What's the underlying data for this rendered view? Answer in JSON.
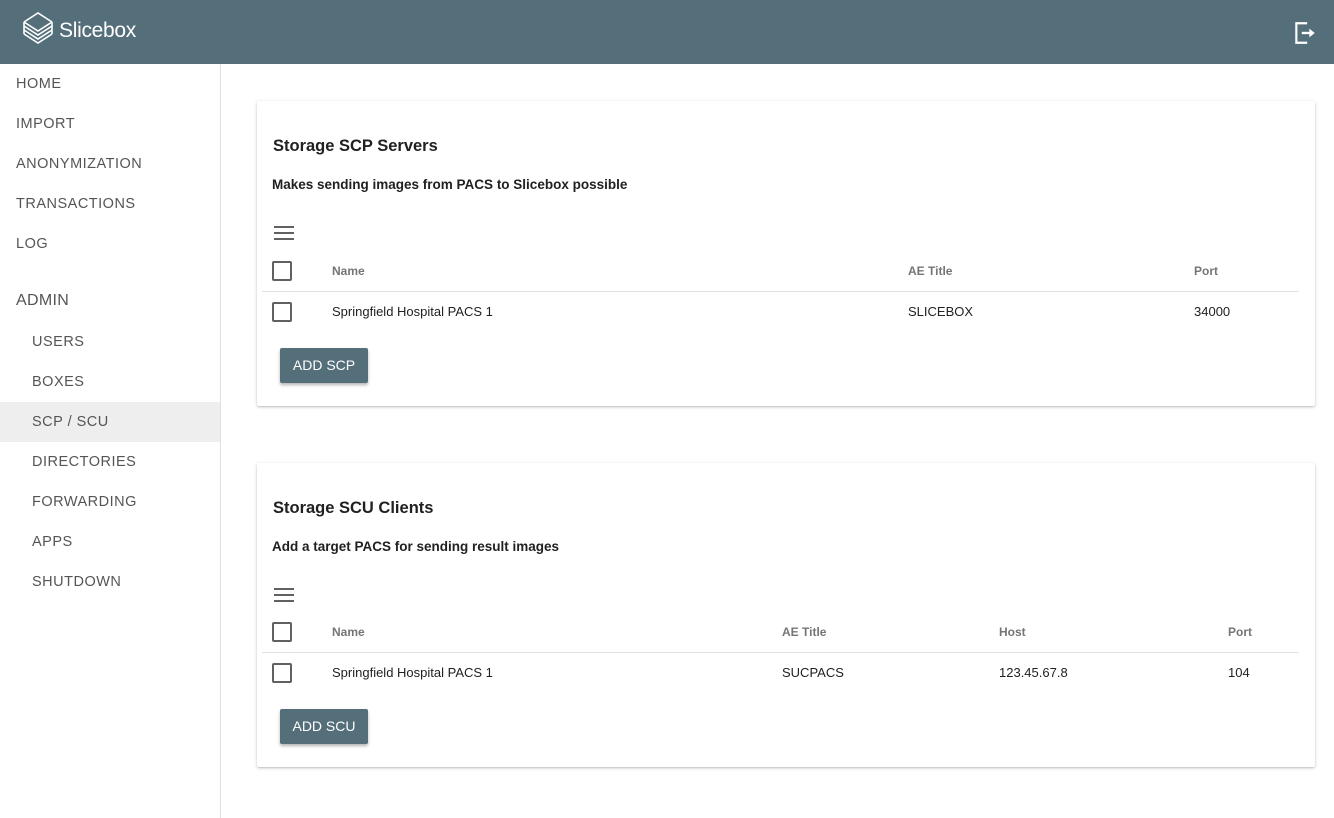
{
  "header": {
    "app_title": "Slicebox",
    "logo_icon": "stack-logo-icon",
    "logout_icon": "logout-icon",
    "background_color": "#546e7a"
  },
  "sidebar": {
    "top_items": [
      {
        "label": "HOME"
      },
      {
        "label": "IMPORT"
      },
      {
        "label": "ANONYMIZATION"
      },
      {
        "label": "TRANSACTIONS"
      },
      {
        "label": "LOG"
      }
    ],
    "admin_header": "ADMIN",
    "admin_items": [
      {
        "label": "USERS"
      },
      {
        "label": "BOXES"
      },
      {
        "label": "SCP / SCU",
        "active": true
      },
      {
        "label": "DIRECTORIES"
      },
      {
        "label": "FORWARDING"
      },
      {
        "label": "APPS"
      },
      {
        "label": "SHUTDOWN"
      }
    ]
  },
  "scp_card": {
    "title": "Storage SCP Servers",
    "subtitle": "Makes sending images from PACS to Slicebox possible",
    "columns": [
      "Name",
      "AE Title",
      "Port"
    ],
    "rows": [
      {
        "name": "Springfield Hospital PACS 1",
        "ae_title": "SLICEBOX",
        "port": "34000"
      }
    ],
    "button_label": "ADD SCP"
  },
  "scu_card": {
    "title": "Storage SCU Clients",
    "subtitle": "Add a target PACS for sending result images",
    "columns": [
      "Name",
      "AE Title",
      "Host",
      "Port"
    ],
    "rows": [
      {
        "name": "Springfield Hospital PACS 1",
        "ae_title": "SUCPACS",
        "host": "123.45.67.8",
        "port": "104"
      }
    ],
    "button_label": "ADD SCU"
  }
}
